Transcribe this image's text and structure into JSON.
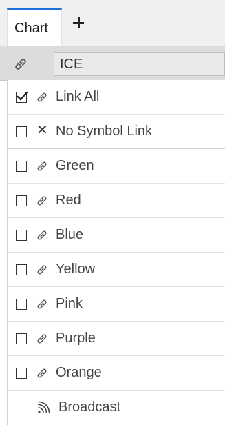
{
  "tabs": [
    {
      "label": "Chart",
      "active": true
    }
  ],
  "add_tab_icon": "plus-icon",
  "symbol": {
    "value": "ICE",
    "icon": "link-icon"
  },
  "link_menu": {
    "items": [
      {
        "label": "Link All",
        "checked": true,
        "icon": "link-icon"
      },
      {
        "label": "No Symbol Link",
        "checked": false,
        "icon": "close-icon"
      },
      {
        "label": "Green",
        "checked": false,
        "icon": "link-icon"
      },
      {
        "label": "Red",
        "checked": false,
        "icon": "link-icon"
      },
      {
        "label": "Blue",
        "checked": false,
        "icon": "link-icon"
      },
      {
        "label": "Yellow",
        "checked": false,
        "icon": "link-icon"
      },
      {
        "label": "Pink",
        "checked": false,
        "icon": "link-icon"
      },
      {
        "label": "Purple",
        "checked": false,
        "icon": "link-icon"
      },
      {
        "label": "Orange",
        "checked": false,
        "icon": "link-icon"
      }
    ],
    "broadcast": {
      "label": "Broadcast",
      "icon": "broadcast-icon"
    }
  },
  "colors": {
    "tab_accent": "#1e6fd9"
  }
}
